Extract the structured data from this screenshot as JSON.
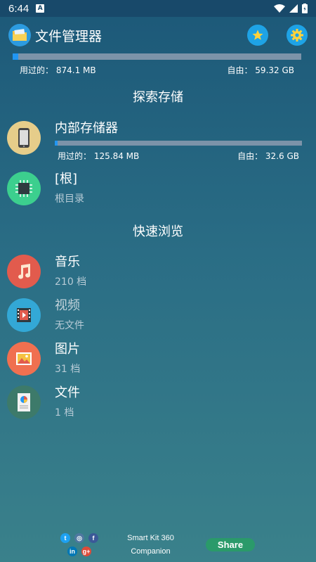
{
  "status_bar": {
    "time": "6:44",
    "notification_glyph": "A"
  },
  "header": {
    "title": "文件管理器"
  },
  "total_storage": {
    "used_label": "用过的：",
    "used_value": "874.1 MB",
    "free_label": "自由：",
    "free_value": "59.32 GB",
    "fill_fraction": 0.02
  },
  "sections": {
    "explore": "探索存储",
    "quick": "快速浏览"
  },
  "storage": [
    {
      "title": "内部存储器",
      "used_label": "用过的：",
      "used_value": "125.84 MB",
      "free_label": "自由：",
      "free_value": "32.6 GB",
      "fill_fraction": 0.01
    },
    {
      "title": "[根]",
      "subtitle": "根目录"
    }
  ],
  "quick": [
    {
      "title": "音乐",
      "subtitle": "210 档",
      "icon": "music-icon"
    },
    {
      "title": "视频",
      "subtitle": "无文件",
      "icon": "video-icon"
    },
    {
      "title": "图片",
      "subtitle": "31 档",
      "icon": "image-icon"
    },
    {
      "title": "文件",
      "subtitle": "1 档",
      "icon": "document-icon"
    }
  ],
  "footer": {
    "companion_line1": "Smart Kit 360",
    "companion_line2": "Companion",
    "share_label": "Share"
  },
  "colors": {
    "accent": "#2196f3",
    "music": "#e25b4d",
    "video": "#33a8d6",
    "image": "#f07050",
    "document": "#3d7a6a",
    "root": "#3ccf8e",
    "phone": "#e6cd8a"
  }
}
